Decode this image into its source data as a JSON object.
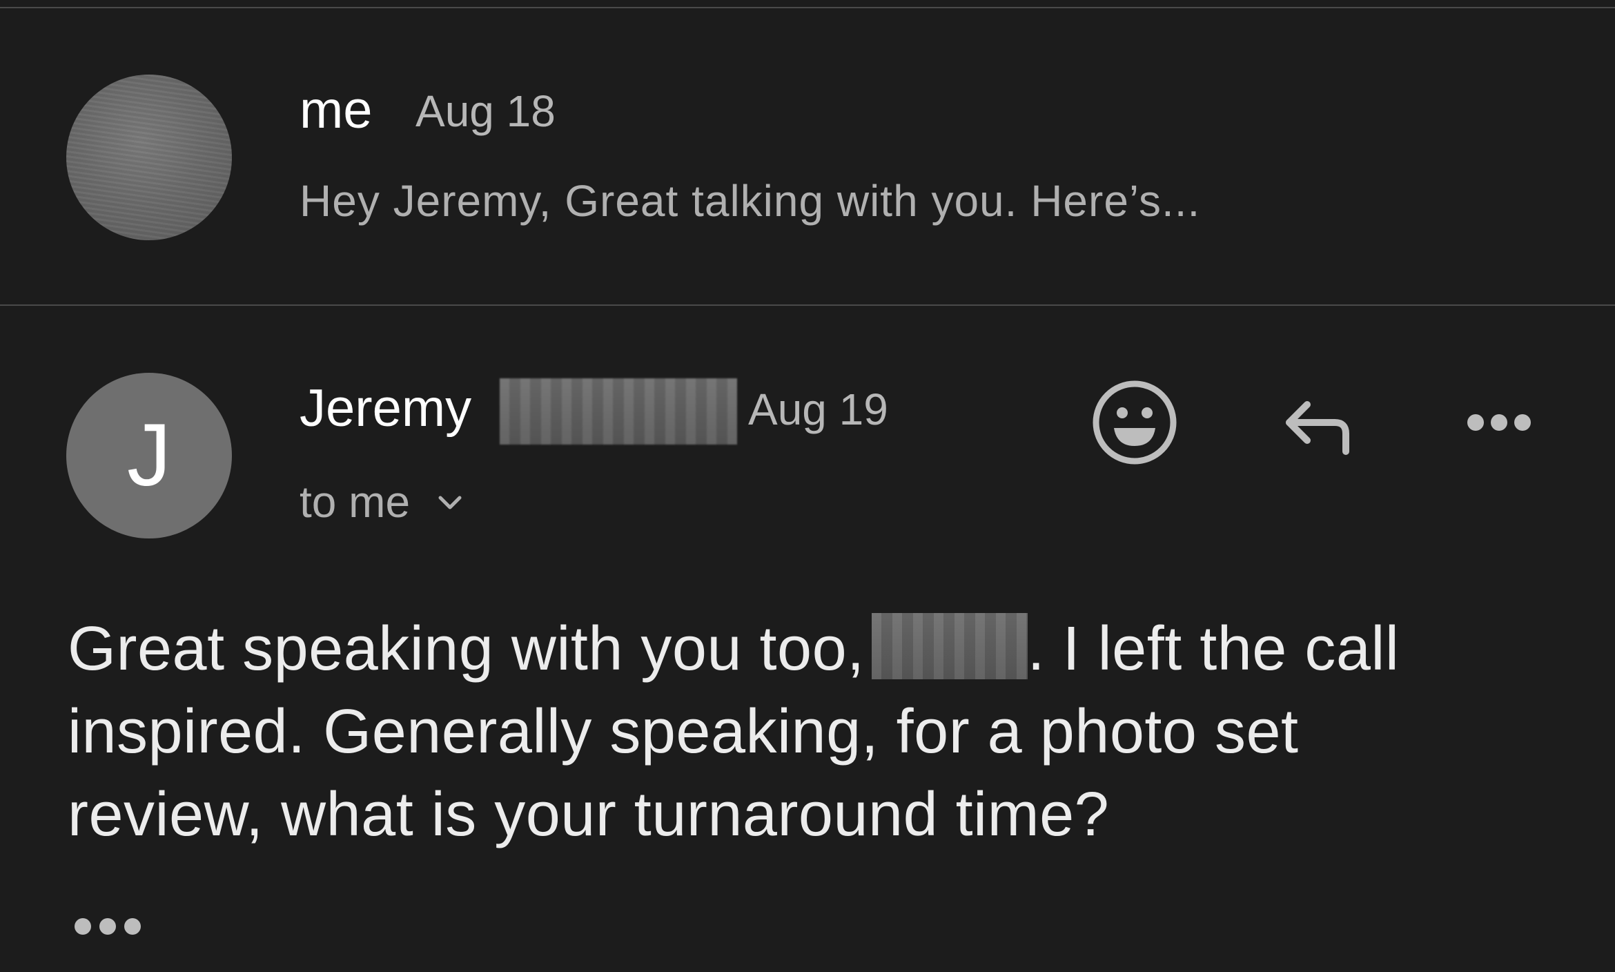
{
  "thread": {
    "collapsed_message": {
      "sender": "me",
      "date": "Aug 18",
      "snippet": "Hey Jeremy, Great talking with you. Here’s..."
    },
    "expanded_message": {
      "avatar_initial": "J",
      "sender": "Jeremy",
      "date": "Aug 19",
      "recipients_label": "to me",
      "body_lines": [
        "Great speaking with you too,",
        ". I left the call",
        "inspired. Generally speaking, for a photo set",
        "review, what is your turnaround time?"
      ]
    }
  },
  "actions": {
    "react_icon": "smiley-face-icon",
    "reply_icon": "reply-arrow-icon",
    "more_icon": "more-horizontal-icon",
    "show_trimmed_icon": "ellipsis-icon"
  },
  "colors": {
    "background": "#1c1c1c",
    "divider": "#4a4a4a",
    "avatar": "#6f6f6f",
    "icon": "#bdbdbd"
  }
}
